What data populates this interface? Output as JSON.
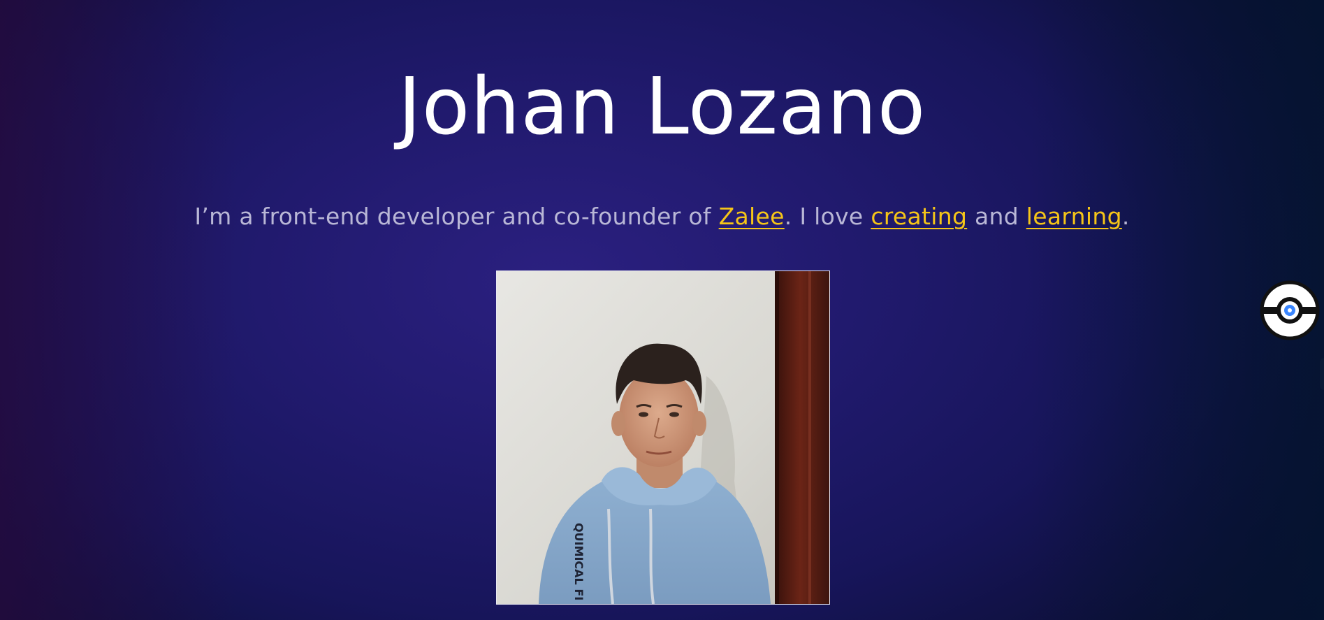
{
  "hero": {
    "name": "Johan Lozano",
    "tagline": {
      "part1": "I’m a front-end developer and co-founder of ",
      "link_company": "Zalee",
      "part2": ". I love ",
      "link_creating": "creating",
      "part3": " and ",
      "link_learning": "learning",
      "part4": "."
    },
    "profile_photo_icon": "portrait-photo",
    "hoodie_print": "QUIMICAL FI"
  },
  "widgets": {
    "theme_toggle_icon": "pokeball-icon"
  },
  "colors": {
    "background": "#211a6e",
    "title": "#ffffff",
    "tagline_text": "#b9b7d6",
    "link_accent": "#f5c518",
    "toggle_accent": "#3a86ff"
  }
}
